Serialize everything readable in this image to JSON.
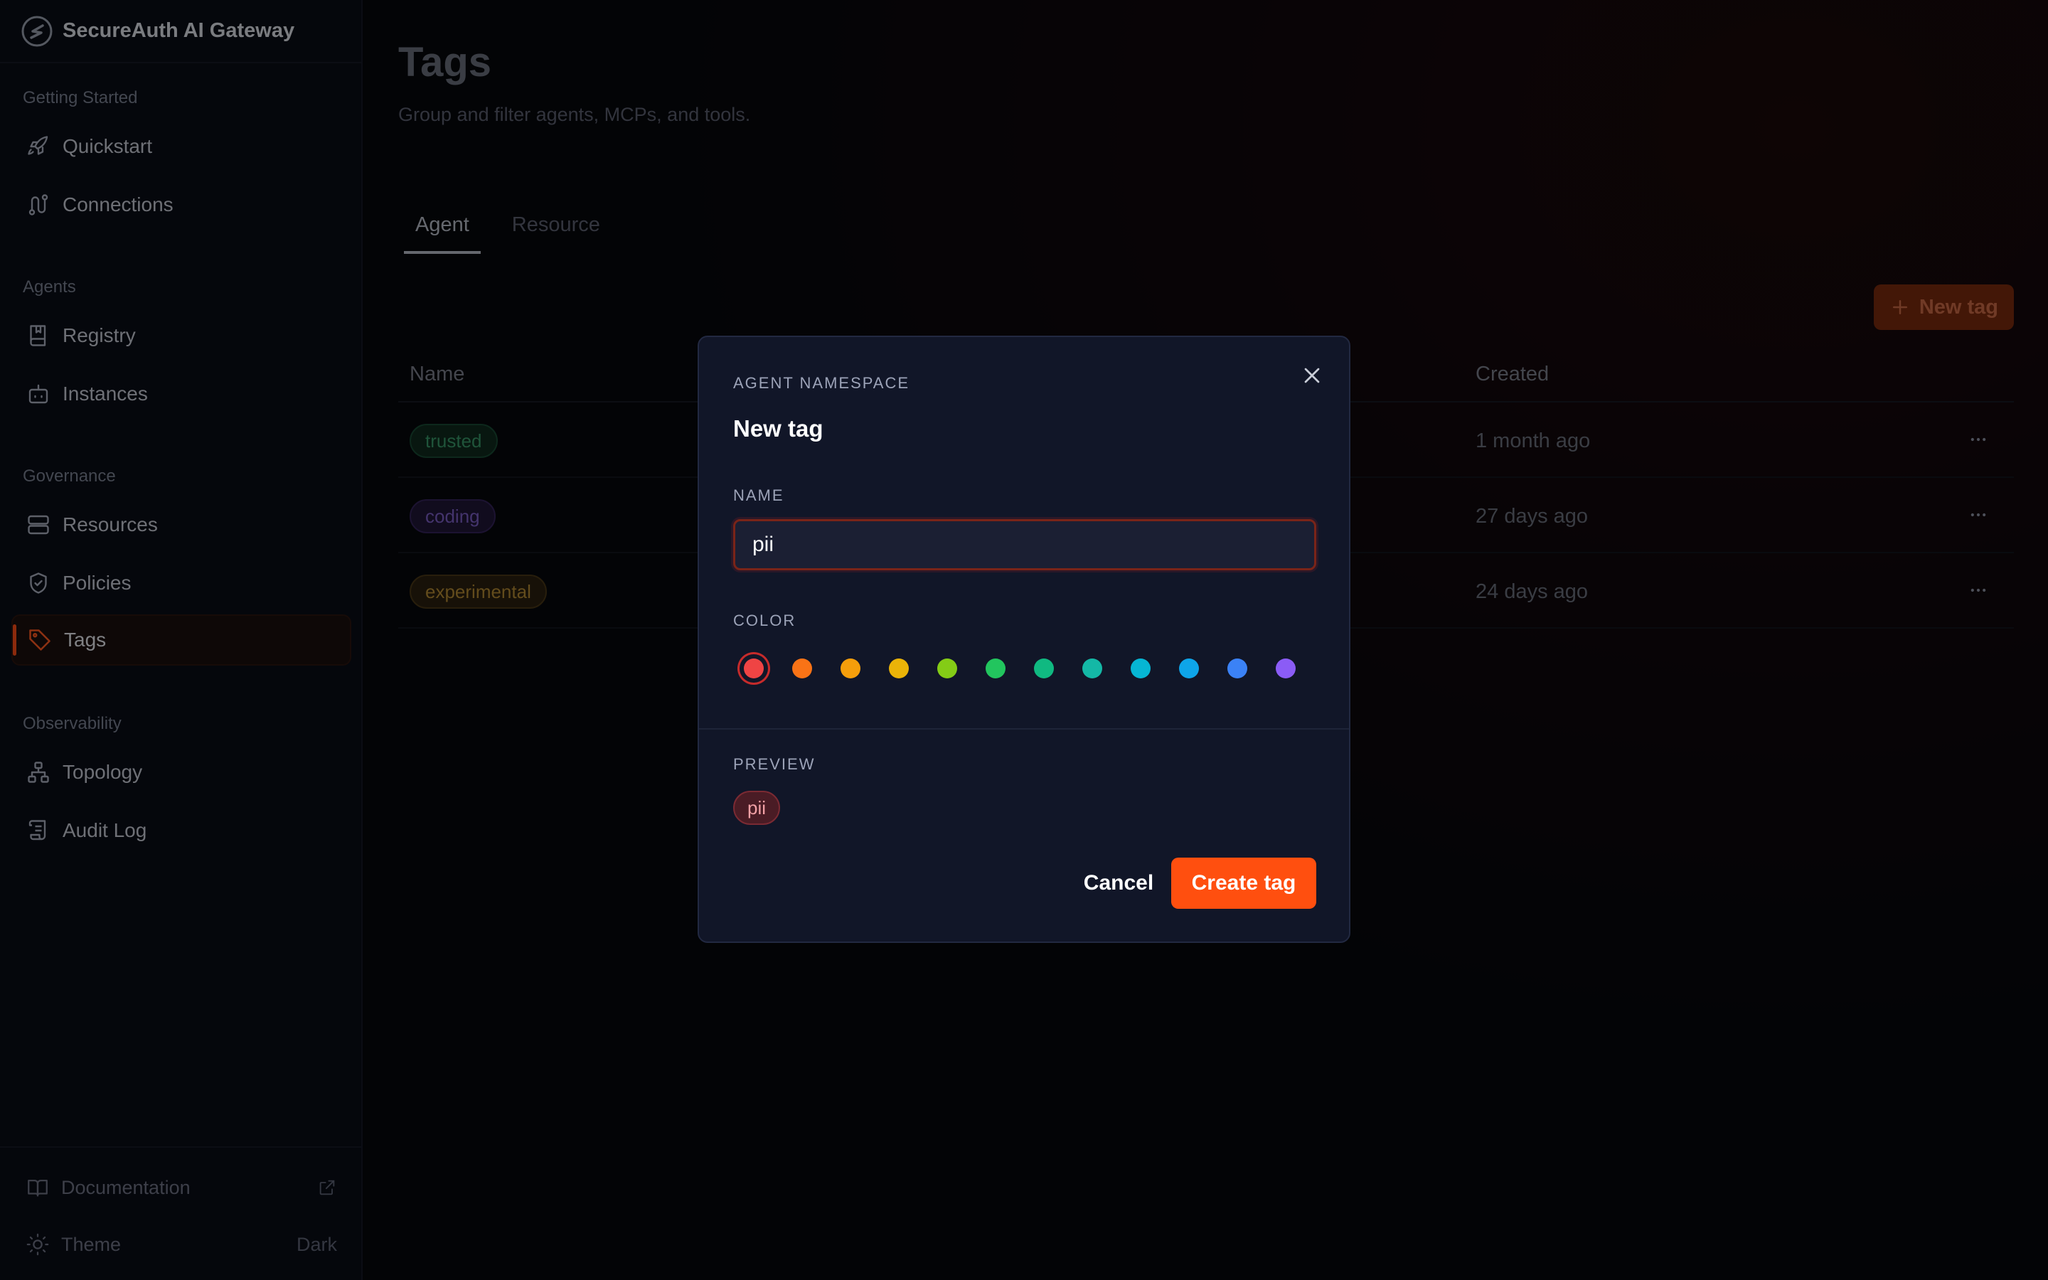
{
  "app": {
    "title": "SecureAuth AI Gateway"
  },
  "sidebar": {
    "sections": [
      {
        "label": "Getting Started"
      },
      {
        "label": "Agents"
      },
      {
        "label": "Governance"
      },
      {
        "label": "Observability"
      }
    ],
    "items": [
      {
        "label": "Quickstart",
        "icon": "rocket-icon"
      },
      {
        "label": "Connections",
        "icon": "route-icon"
      },
      {
        "label": "Registry",
        "icon": "book-icon"
      },
      {
        "label": "Instances",
        "icon": "bot-icon"
      },
      {
        "label": "Resources",
        "icon": "server-icon"
      },
      {
        "label": "Policies",
        "icon": "shield-icon"
      },
      {
        "label": "Tags",
        "icon": "tag-icon",
        "active": true
      },
      {
        "label": "Topology",
        "icon": "topology-icon"
      },
      {
        "label": "Audit Log",
        "icon": "scroll-icon"
      }
    ],
    "footer": {
      "documentation": "Documentation",
      "theme_label": "Theme",
      "theme_value": "Dark"
    }
  },
  "page": {
    "title": "Tags",
    "subtitle": "Group and filter agents, MCPs, and tools.",
    "tabs": [
      {
        "label": "Agent",
        "active": true
      },
      {
        "label": "Resource",
        "active": false
      }
    ],
    "new_tag_button": "New tag",
    "table": {
      "columns": [
        "Name",
        "Created"
      ],
      "rows": [
        {
          "name": "trusted",
          "color": "#2fa56b",
          "created": "1 month ago"
        },
        {
          "name": "coding",
          "color": "#8b5cf6",
          "created": "27 days ago"
        },
        {
          "name": "experimental",
          "color": "#d4a12a",
          "created": "24 days ago"
        }
      ]
    }
  },
  "modal": {
    "eyebrow": "AGENT NAMESPACE",
    "title": "New tag",
    "name_label": "NAME",
    "name_value": "pii",
    "color_label": "COLOR",
    "colors": [
      "#ef4444",
      "#f97316",
      "#f59e0b",
      "#eab308",
      "#84cc16",
      "#22c55e",
      "#10b981",
      "#14b8a6",
      "#06b6d4",
      "#0ea5e9",
      "#3b82f6",
      "#8b5cf6"
    ],
    "selected_color": "#ef4444",
    "preview_label": "PREVIEW",
    "preview_text": "pii",
    "cancel_label": "Cancel",
    "create_label": "Create tag"
  }
}
